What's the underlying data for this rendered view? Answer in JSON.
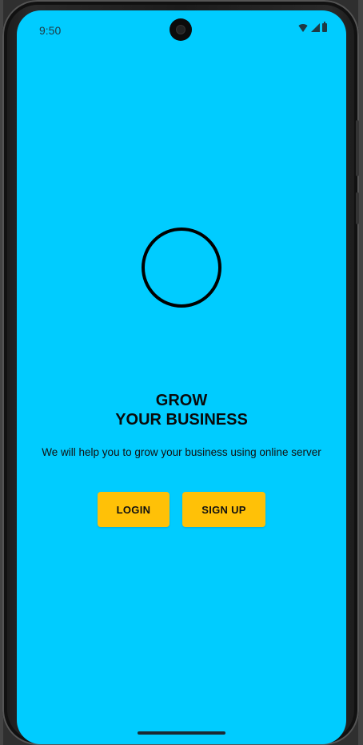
{
  "status_bar": {
    "time": "9:50",
    "icons": [
      "wifi-icon",
      "signal-icon",
      "battery-icon"
    ]
  },
  "logo": {
    "icon": "circle-logo-icon"
  },
  "headline": {
    "line1": "GROW",
    "line2": "YOUR BUSINESS"
  },
  "tagline": "We will help you to grow your business using online server",
  "buttons": {
    "login": "LOGIN",
    "signup": "SIGN UP"
  },
  "colors": {
    "background": "#00CCFF",
    "button": "#FFC107",
    "text": "#0a0a0a"
  }
}
